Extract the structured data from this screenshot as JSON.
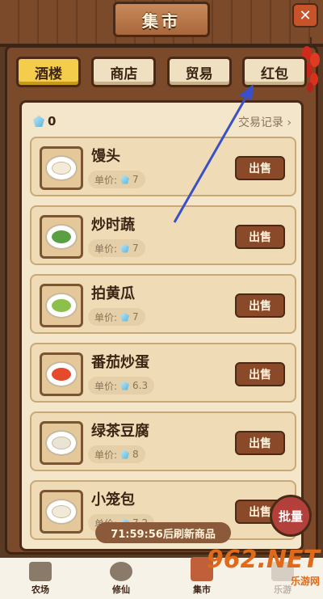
{
  "header": {
    "title": "集市",
    "close_label": "✕"
  },
  "tabs": [
    {
      "label": "酒楼",
      "active": true
    },
    {
      "label": "商店",
      "active": false
    },
    {
      "label": "贸易",
      "active": false
    },
    {
      "label": "红包",
      "active": false
    }
  ],
  "currency": {
    "count": "0",
    "icon": "gem-icon"
  },
  "history_link": "交易记录 ›",
  "price_label": "单价:",
  "sell_label": "出售",
  "items": [
    {
      "name": "馒头",
      "price": "7",
      "food_color": "#f3ead8"
    },
    {
      "name": "炒时蔬",
      "price": "7",
      "food_color": "#5aa043"
    },
    {
      "name": "拍黄瓜",
      "price": "7",
      "food_color": "#8cc04a"
    },
    {
      "name": "番茄炒蛋",
      "price": "6.3",
      "food_color": "#e64a2a"
    },
    {
      "name": "绿茶豆腐",
      "price": "8",
      "food_color": "#e8e4d6"
    },
    {
      "name": "小笼包",
      "price": "7.2",
      "food_color": "#f0ead8"
    }
  ],
  "timer_text": "71:59:56后刷新商品",
  "batch_label": "批量",
  "bottom_nav": [
    {
      "label": "农场",
      "active": false
    },
    {
      "label": "修仙",
      "active": false
    },
    {
      "label": "集市",
      "active": true
    },
    {
      "label": "乐游",
      "active": false
    }
  ],
  "watermark": {
    "main": "962.NET",
    "sub": "乐游网"
  },
  "colors": {
    "accent": "#f3cd4b",
    "wood": "#7b4a2a",
    "arrow": "#3a4fc8"
  }
}
